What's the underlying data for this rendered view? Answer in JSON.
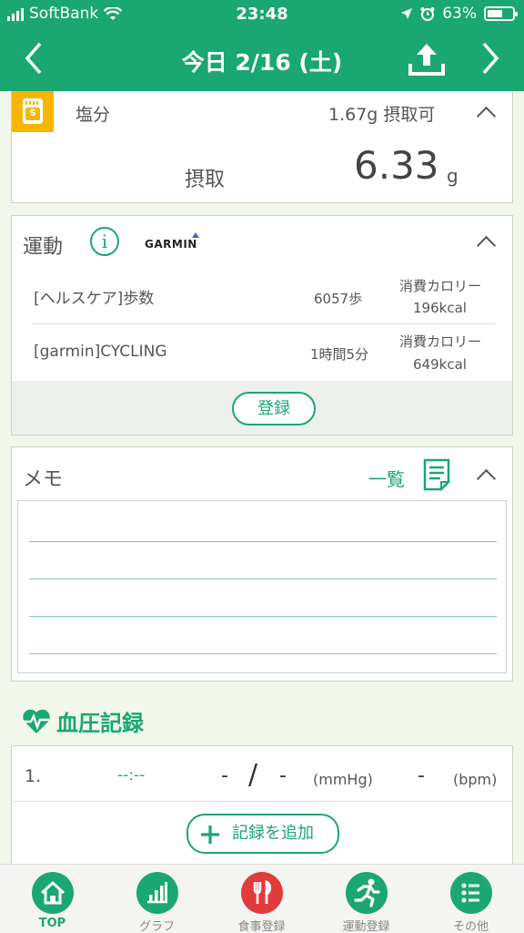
{
  "status": {
    "carrier": "SoftBank",
    "time": "23:48",
    "battery": "63%",
    "battery_level": 0.63
  },
  "header": {
    "title": "今日 2/16 (土)"
  },
  "salt": {
    "label": "塩分",
    "remaining": "1.67g 摂取可",
    "intake_label": "摂取",
    "intake_value": "6.33",
    "intake_unit": "g"
  },
  "exercise": {
    "title": "運動",
    "brand": "GARMIN",
    "items": [
      {
        "name": "[ヘルスケア]歩数",
        "amount": "6057歩",
        "cal_label": "消費カロリー",
        "cal": "196kcal"
      },
      {
        "name": "[garmin]CYCLING",
        "amount": "1時間5分",
        "cal_label": "消費カロリー",
        "cal": "649kcal"
      }
    ],
    "register": "登録"
  },
  "memo": {
    "title": "メモ",
    "list_link": "一覧"
  },
  "bp": {
    "title": "血圧記録",
    "row": {
      "index": "1.",
      "time": "--:--",
      "sys": "-",
      "slash": "/",
      "dia": "-",
      "unit": "(mmHg)",
      "pulse": "-",
      "pulse_unit": "(bpm)"
    },
    "add": "記録を追加"
  },
  "tabs": [
    "TOP",
    "グラフ",
    "食事登録",
    "運動登録",
    "その他"
  ],
  "colors": {
    "primary": "#1aa772",
    "salt_icon": "#f7b500",
    "meal_icon": "#e23b3b"
  }
}
